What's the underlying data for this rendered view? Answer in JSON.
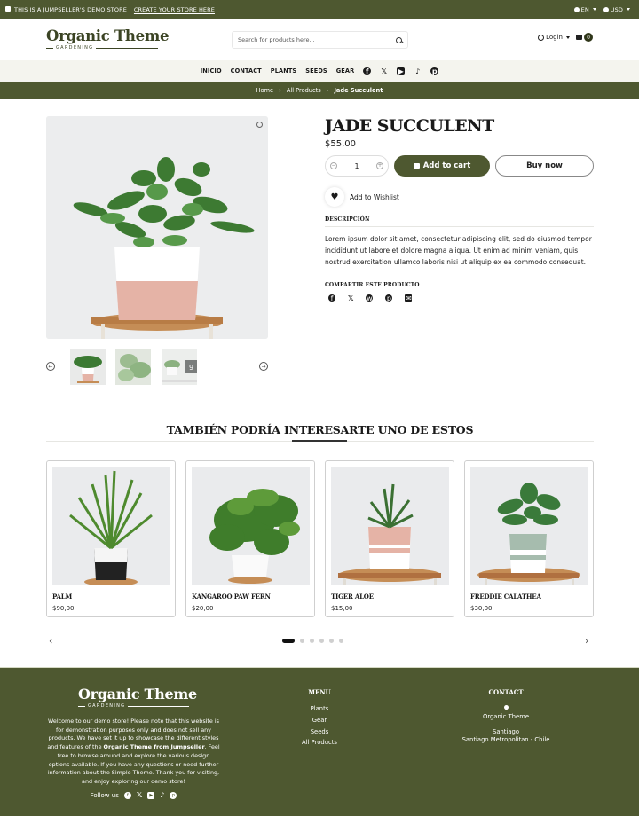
{
  "topbar": {
    "demo_notice": "THIS IS A JUMPSELLER'S DEMO STORE",
    "create_link": "CREATE YOUR STORE HERE",
    "language": "EN",
    "currency": "USD"
  },
  "header": {
    "logo_name": "Organic Theme",
    "logo_sub": "GARDENING",
    "search_placeholder": "Search for products here...",
    "login_label": "Login",
    "cart_count": "0"
  },
  "nav": {
    "items": [
      "INICIO",
      "CONTACT",
      "PLANTS",
      "SEEDS",
      "GEAR"
    ],
    "social": [
      "facebook",
      "x",
      "youtube",
      "tiktok",
      "pinterest"
    ]
  },
  "breadcrumb": {
    "items": [
      "Home",
      "All Products"
    ],
    "current": "Jade Succulent",
    "separator": "›"
  },
  "product": {
    "title": "JADE SUCCULENT",
    "price": "$55,00",
    "quantity": "1",
    "add_to_cart_label": "Add to cart",
    "buy_now_label": "Buy now",
    "wishlist_label": "Add to Wishlist",
    "description_heading": "DESCRIPCIÓN",
    "description": "Lorem ipsum dolor sit amet, consectetur adipiscing elit, sed do eiusmod tempor incididunt ut labore et dolore magna aliqua. Ut enim ad minim veniam, quis nostrud exercitation ullamco laboris nisi ut aliquip ex ea commodo consequat.",
    "share_heading": "COMPARTIR ESTE PRODUCTO",
    "share_icons": [
      "facebook",
      "x",
      "whatsapp",
      "pinterest",
      "email"
    ],
    "thumbnail_count_badge": "9"
  },
  "related": {
    "heading": "TAMBIÉN PODRÍA INTERESARTE UNO DE ESTOS",
    "products": [
      {
        "name": "PALM",
        "price": "$90,00"
      },
      {
        "name": "KANGAROO PAW FERN",
        "price": "$20,00"
      },
      {
        "name": "TIGER ALOE",
        "price": "$15,00"
      },
      {
        "name": "FREDDIE CALATHEA",
        "price": "$30,00"
      }
    ],
    "pages": 6,
    "active_page": 1
  },
  "footer": {
    "logo_name": "Organic Theme",
    "logo_sub": "GARDENING",
    "text_before": "Welcome to our demo store! Please note that this website is for demonstration purposes only and does not sell any products. We have set it up to showcase the different styles and features of the ",
    "text_bold": "Organic Theme from Jumpseller",
    "text_after": ". Feel free to browse around and explore the various design options available. If you have any questions or need further information about the Simple Theme. Thank you for visiting, and enjoy exploring our demo store!",
    "follow_label": "Follow us",
    "menu_heading": "MENU",
    "menu_items": [
      "Plants",
      "Gear",
      "Seeds",
      "All Products"
    ],
    "contact_heading": "CONTACT",
    "contact_name": "Organic Theme",
    "contact_city": "Santiago",
    "contact_region": "Santiago Metropolitan - Chile"
  },
  "colors": {
    "brand_olive": "#4e5830",
    "cream": "#f4f4ee"
  }
}
